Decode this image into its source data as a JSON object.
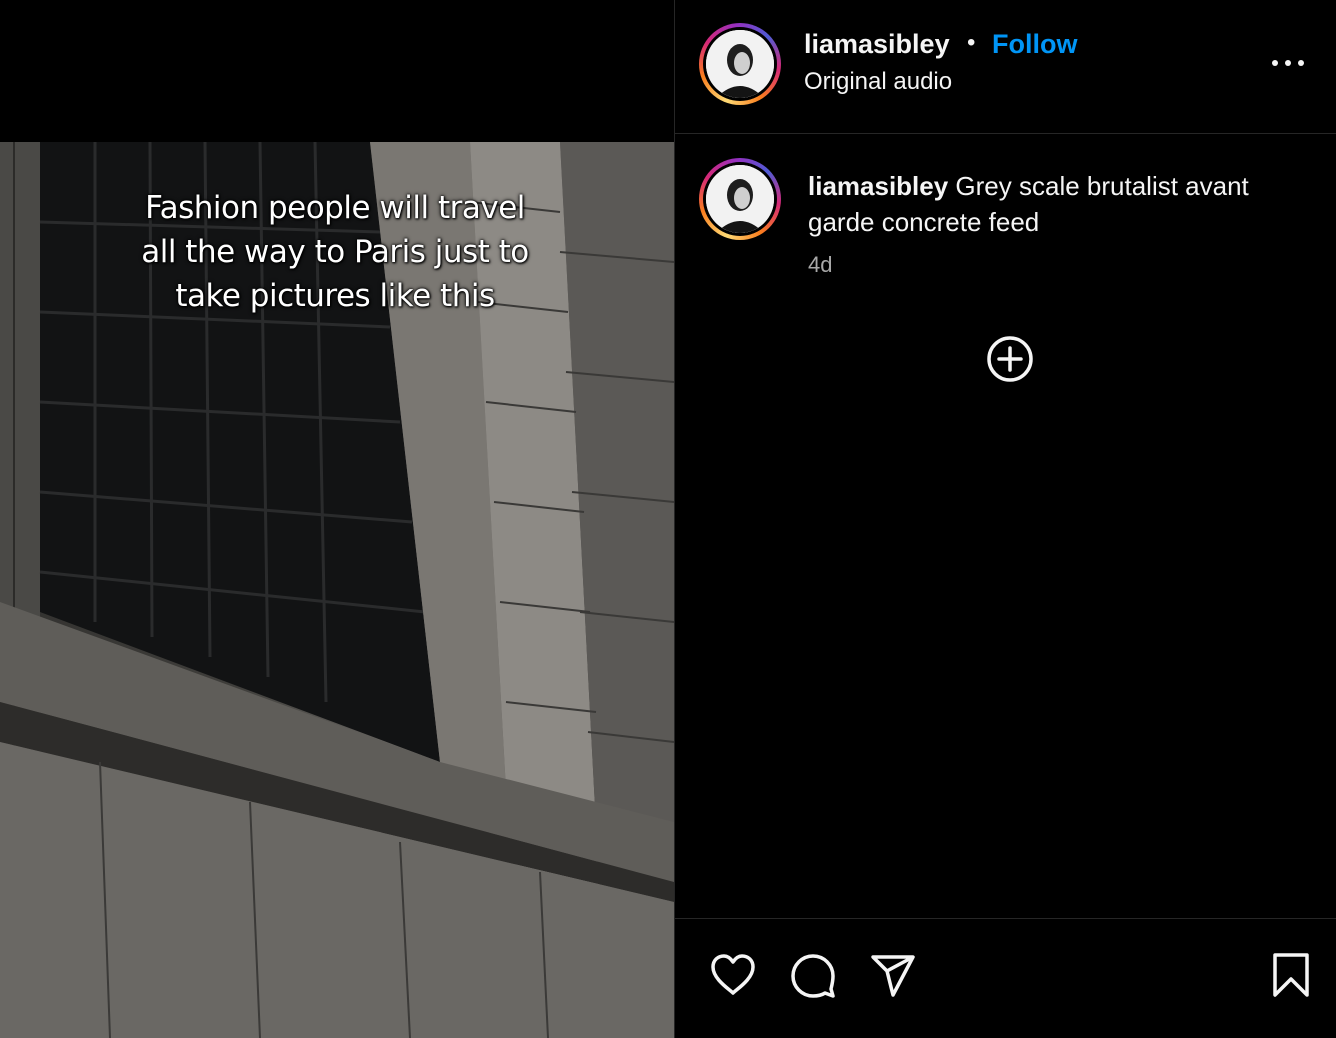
{
  "post": {
    "overlay_text": "Fashion people will travel\nall the way to Paris just to\ntake pictures like this"
  },
  "header": {
    "username": "liamasibley",
    "separator": "•",
    "follow_label": "Follow",
    "audio_label": "Original audio"
  },
  "caption": {
    "username": "liamasibley",
    "text": " Grey scale brutalist avant garde concrete feed",
    "time": "4d"
  },
  "actions": {
    "likes": "",
    "icons": [
      "heart-icon",
      "comment-icon",
      "share-icon",
      "bookmark-icon"
    ]
  },
  "colors": {
    "background": "#000000",
    "link": "#0095f6",
    "border": "#262626",
    "muted": "#a8a8a8"
  }
}
